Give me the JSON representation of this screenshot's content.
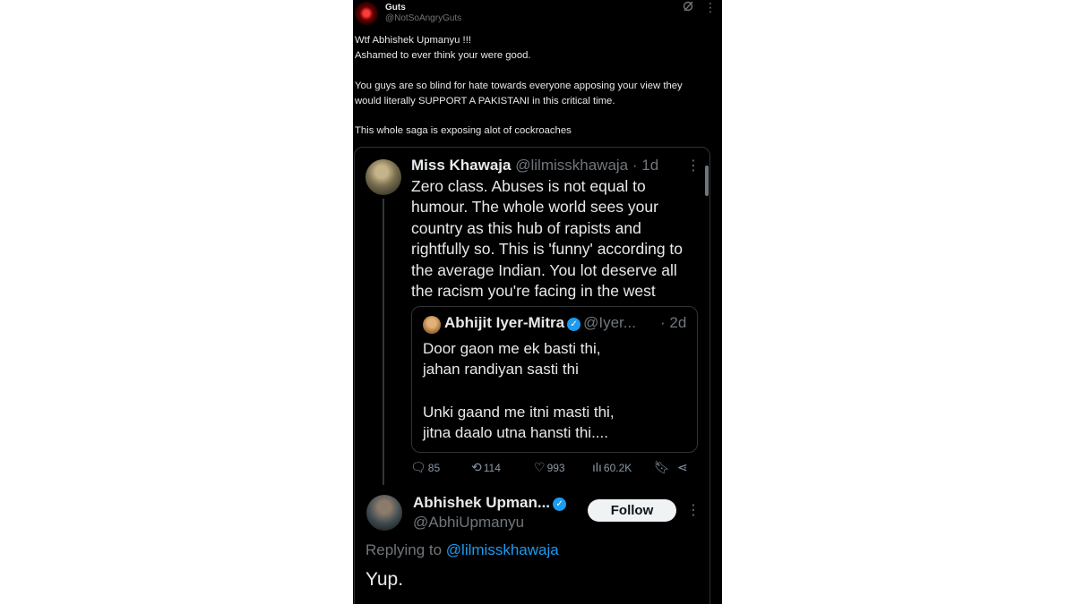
{
  "outer_tweet": {
    "author_name": "Guts",
    "author_handle": "@NotSoAngryGuts",
    "lines": [
      "Wtf Abhishek Upmanyu !!!",
      "Ashamed to ever think your were good.",
      "You guys are so blind for hate towards everyone apposing your view they",
      "would literally SUPPORT A PAKISTANI in this critical time.",
      "This whole saga is exposing alot of cockroaches"
    ]
  },
  "embedded": {
    "tweet": {
      "author_name": "Miss Khawaja",
      "meta": "@lilmisskhawaja · 1d",
      "lines": [
        "Zero class. Abuses is not equal to",
        "humour. The whole world sees your",
        "country as this hub of rapists and",
        "rightfully so. This is 'funny' according to",
        "the average Indian. You lot deserve all",
        "the racism you're facing in the west"
      ]
    },
    "quote": {
      "author_name": "Abhijit Iyer-Mitra",
      "author_handle": "@Iyer...",
      "time": "· 2d",
      "lines": [
        "Door gaon me ek basti thi,",
        "jahan randiyan  sasti thi",
        "Unki gaand me itni masti thi,",
        "jitna daalo utna hansti thi...."
      ]
    },
    "actions": {
      "replies": "85",
      "reposts": "114",
      "likes": "993",
      "views": "60.2K"
    },
    "reply": {
      "author_name": "Abhishek Upman...",
      "author_handle": "@AbhiUpmanyu",
      "follow_label": "Follow",
      "replying_prefix": "Replying to",
      "replying_mention": "@lilmisskhawaja",
      "text": "Yup."
    }
  },
  "colors": {
    "background": "#000000",
    "text": "#e7e9ea",
    "muted": "#71767b",
    "accent": "#1d9bf0"
  }
}
